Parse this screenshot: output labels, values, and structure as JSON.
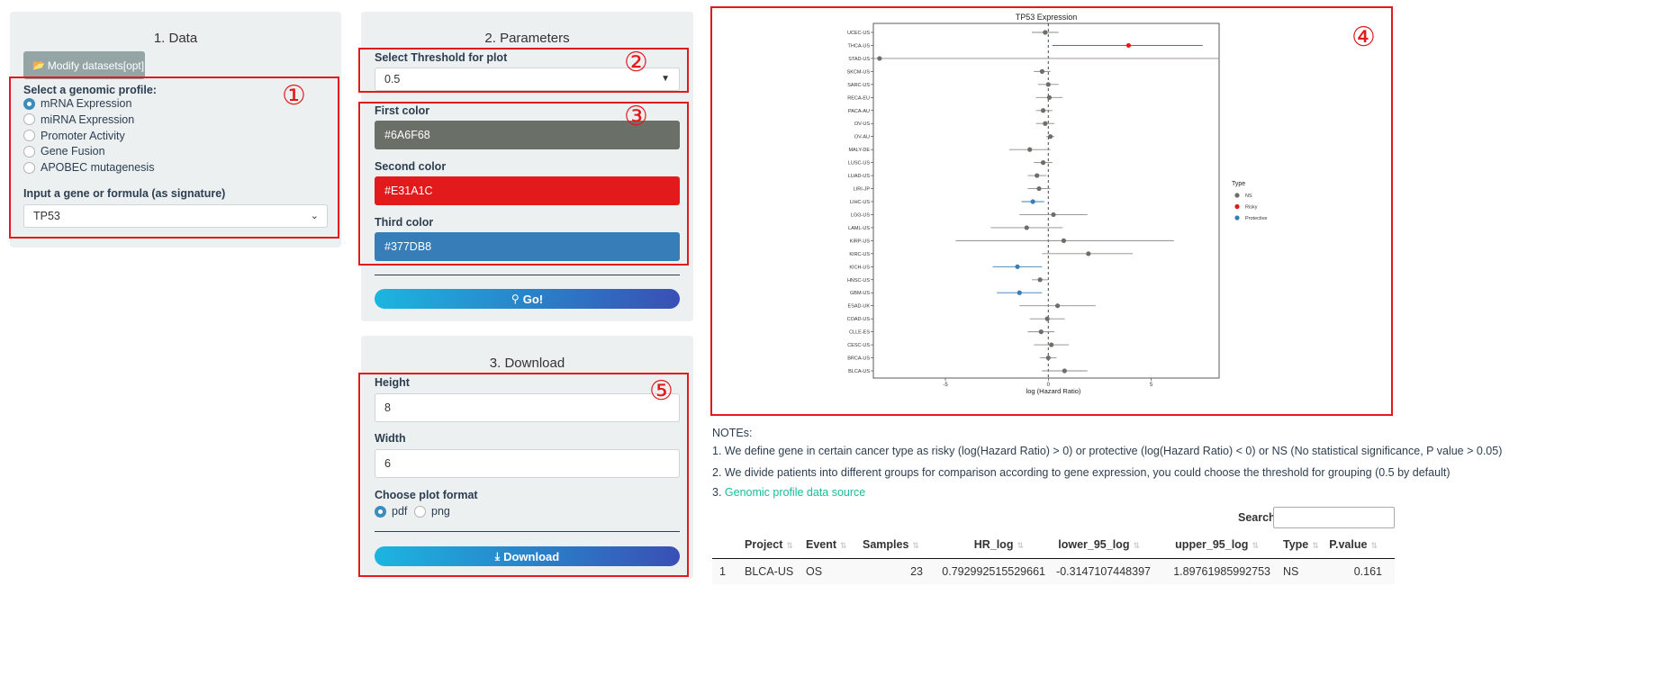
{
  "data_panel": {
    "title": "1. Data",
    "modify_button": "Modify datasets[opt]",
    "profile_label": "Select a genomic profile:",
    "profiles": [
      {
        "label": "mRNA Expression",
        "selected": true
      },
      {
        "label": "miRNA Expression",
        "selected": false
      },
      {
        "label": "Promoter Activity",
        "selected": false
      },
      {
        "label": "Gene Fusion",
        "selected": false
      },
      {
        "label": "APOBEC mutagenesis",
        "selected": false
      }
    ],
    "gene_label": "Input a gene or formula (as signature)",
    "gene_value": "TP53"
  },
  "params_panel": {
    "title": "2. Parameters",
    "threshold_label": "Select Threshold for plot",
    "threshold_value": "0.5",
    "first_color_label": "First color",
    "first_color": "#6A6F68",
    "second_color_label": "Second color",
    "second_color": "#E31A1C",
    "third_color_label": "Third color",
    "third_color": "#377DB8",
    "go_button": "Go!"
  },
  "download_panel": {
    "title": "3. Download",
    "height_label": "Height",
    "height_value": "8",
    "width_label": "Width",
    "width_value": "6",
    "format_label": "Choose plot format",
    "formats": [
      {
        "label": "pdf",
        "selected": true
      },
      {
        "label": "png",
        "selected": false
      }
    ],
    "download_button": "Download"
  },
  "annotations": [
    "①",
    "②",
    "③",
    "④",
    "⑤"
  ],
  "chart_data": {
    "type": "scatter",
    "title": "TP53 Expression",
    "xlabel": "log (Hazard Ratio)",
    "ylabel": "",
    "xlim": [
      -8.5,
      8.3
    ],
    "x_ticks": [
      "-5",
      "0",
      "5"
    ],
    "legend_title": "Type",
    "legend": [
      "NS",
      "Risky",
      "Protective"
    ],
    "colors": {
      "NS": "#6A6F68",
      "Risky": "#E31A1C",
      "Protective": "#377DB8"
    },
    "series": [
      {
        "cat": "UCEC-US",
        "hr": -0.15,
        "lo": -0.8,
        "hi": 0.5,
        "type": "NS"
      },
      {
        "cat": "THCA-US",
        "hr": 3.9,
        "lo": 0.2,
        "hi": 7.5,
        "type": "Risky"
      },
      {
        "cat": "STAD-US",
        "hr": -8.2,
        "lo": -8.5,
        "hi": 8.3,
        "type": "NS"
      },
      {
        "cat": "SKCM-US",
        "hr": -0.3,
        "lo": -0.7,
        "hi": 0.1,
        "type": "NS"
      },
      {
        "cat": "SARC-US",
        "hr": 0.0,
        "lo": -0.5,
        "hi": 0.5,
        "type": "NS"
      },
      {
        "cat": "RECA-EU",
        "hr": 0.05,
        "lo": -0.6,
        "hi": 0.7,
        "type": "NS"
      },
      {
        "cat": "PACA-AU",
        "hr": -0.25,
        "lo": -0.6,
        "hi": 0.2,
        "type": "NS"
      },
      {
        "cat": "OV-US",
        "hr": -0.15,
        "lo": -0.6,
        "hi": 0.3,
        "type": "NS"
      },
      {
        "cat": "OV-AU",
        "hr": 0.1,
        "lo": -0.1,
        "hi": 0.3,
        "type": "NS"
      },
      {
        "cat": "MALY-DE",
        "hr": -0.9,
        "lo": -1.9,
        "hi": 0.1,
        "type": "NS"
      },
      {
        "cat": "LUSC-US",
        "hr": -0.25,
        "lo": -0.7,
        "hi": 0.2,
        "type": "NS"
      },
      {
        "cat": "LUAD-US",
        "hr": -0.55,
        "lo": -1.0,
        "hi": -0.1,
        "type": "NS"
      },
      {
        "cat": "LIRI-JP",
        "hr": -0.45,
        "lo": -1.0,
        "hi": 0.1,
        "type": "NS"
      },
      {
        "cat": "LIHC-US",
        "hr": -0.75,
        "lo": -1.3,
        "hi": -0.2,
        "type": "Protective"
      },
      {
        "cat": "LGG-US",
        "hr": 0.25,
        "lo": -1.4,
        "hi": 1.9,
        "type": "NS"
      },
      {
        "cat": "LAML-US",
        "hr": -1.05,
        "lo": -2.8,
        "hi": 0.7,
        "type": "NS"
      },
      {
        "cat": "KIRP-US",
        "hr": 0.75,
        "lo": -4.5,
        "hi": 6.1,
        "type": "NS"
      },
      {
        "cat": "KIRC-US",
        "hr": 1.95,
        "lo": -0.3,
        "hi": 4.1,
        "type": "NS"
      },
      {
        "cat": "KICH-US",
        "hr": -1.5,
        "lo": -2.7,
        "hi": -0.3,
        "type": "Protective"
      },
      {
        "cat": "HNSC-US",
        "hr": -0.4,
        "lo": -0.8,
        "hi": 0.0,
        "type": "NS"
      },
      {
        "cat": "GBM-US",
        "hr": -1.4,
        "lo": -2.5,
        "hi": -0.3,
        "type": "Protective"
      },
      {
        "cat": "ESAD-UK",
        "hr": 0.45,
        "lo": -1.4,
        "hi": 2.3,
        "type": "NS"
      },
      {
        "cat": "COAD-US",
        "hr": -0.05,
        "lo": -0.9,
        "hi": 0.8,
        "type": "NS"
      },
      {
        "cat": "CLLE-ES",
        "hr": -0.35,
        "lo": -1.0,
        "hi": 0.3,
        "type": "NS"
      },
      {
        "cat": "CESC-US",
        "hr": 0.15,
        "lo": -0.7,
        "hi": 1.0,
        "type": "NS"
      },
      {
        "cat": "BRCA-US",
        "hr": 0.0,
        "lo": -0.4,
        "hi": 0.4,
        "type": "NS"
      },
      {
        "cat": "BLCA-US",
        "hr": 0.79,
        "lo": -0.31,
        "hi": 1.9,
        "type": "NS"
      }
    ]
  },
  "notes": {
    "header": "NOTEs:",
    "n1": "1. We define gene in certain cancer type as risky (log(Hazard Ratio) > 0) or protective (log(Hazard Ratio) < 0) or NS (No statistical significance, P value > 0.05)",
    "n2": "2. We divide patients into different groups for comparison according to gene expression, you could choose the threshold for grouping (0.5 by default)",
    "n3_prefix": "3. ",
    "n3_link": "Genomic profile data source"
  },
  "table": {
    "search_label": "Search:",
    "search_value": "",
    "headers": [
      "Project",
      "Event",
      "Samples",
      "HR_log",
      "lower_95_log",
      "upper_95_log",
      "Type",
      "P.value"
    ],
    "rows": [
      {
        "index": "1",
        "project": "BLCA-US",
        "event": "OS",
        "samples": "23",
        "hr_log": "0.792992515529661",
        "lower": "-0.3147107448397",
        "upper": "1.89761985992753",
        "type": "NS",
        "p": "0.161"
      }
    ]
  }
}
